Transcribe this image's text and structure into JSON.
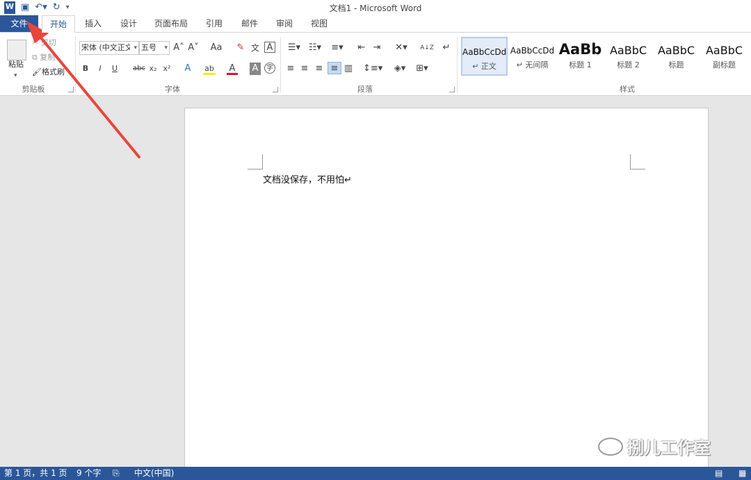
{
  "window": {
    "title": "文档1 - Microsoft Word"
  },
  "qat": {
    "logo": "W",
    "save_icon": "save-icon",
    "undo_icon": "undo-icon",
    "redo_icon": "redo-icon",
    "customize_icon": "customize-qat-icon"
  },
  "tabs": [
    {
      "label": "文件"
    },
    {
      "label": "开始"
    },
    {
      "label": "插入"
    },
    {
      "label": "设计"
    },
    {
      "label": "页面布局"
    },
    {
      "label": "引用"
    },
    {
      "label": "邮件"
    },
    {
      "label": "审阅"
    },
    {
      "label": "视图"
    }
  ],
  "clipboard": {
    "paste": "粘贴",
    "cut": "剪切",
    "copy": "复制",
    "format_painter": "格式刷",
    "group_label": "剪贴板"
  },
  "font": {
    "font_name": "宋体 (中文正文)",
    "font_size": "五号",
    "grow": "A˄",
    "shrink": "A˅",
    "case": "Aa",
    "bold": "B",
    "italic": "I",
    "underline": "U",
    "strike": "abc",
    "sub": "x₂",
    "sup": "x²",
    "effects": "A",
    "highlight": "ab",
    "color": "A",
    "shade": "A",
    "enclose": "字",
    "phonetic": "文",
    "border": "A",
    "group_label": "字体"
  },
  "paragraph": {
    "group_label": "段落",
    "sort": "A↓Z"
  },
  "styles": {
    "group_label": "样式",
    "items": [
      {
        "sample": "AaBbCcDd",
        "name": "↵ 正文"
      },
      {
        "sample": "AaBbCcDd",
        "name": "↵ 无间隔"
      },
      {
        "sample": "AaBb",
        "name": "标题 1"
      },
      {
        "sample": "AaBbC",
        "name": "标题 2"
      },
      {
        "sample": "AaBbC",
        "name": "标题"
      },
      {
        "sample": "AaBbC",
        "name": "副标题"
      }
    ]
  },
  "document": {
    "body_text": "文档没保存，不用怕↵"
  },
  "watermark": {
    "text": "捌儿工作室"
  },
  "status": {
    "page": "第 1 页，共 1 页",
    "words": "9 个字",
    "language": "中文(中国)"
  },
  "colors": {
    "accent": "#2b579a",
    "annotation_arrow": "#e8453c"
  }
}
